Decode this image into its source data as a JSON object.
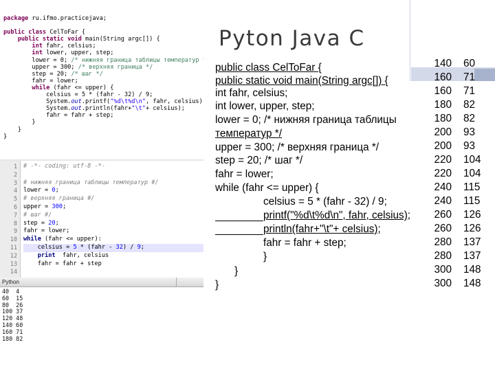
{
  "slide": {
    "title": "Pyton Java C"
  },
  "java_panel": {
    "lines": [
      [
        {
          "t": "package ",
          "c": "kw"
        },
        {
          "t": "ru.ifmo.practicejava;",
          "c": ""
        }
      ],
      [
        {
          "t": "",
          "c": ""
        }
      ],
      [
        {
          "t": "public class ",
          "c": "kw"
        },
        {
          "t": "CelToFar {",
          "c": ""
        }
      ],
      [
        {
          "t": "    ",
          "c": ""
        },
        {
          "t": "public static void ",
          "c": "kw"
        },
        {
          "t": "main(String argc[]) {",
          "c": ""
        }
      ],
      [
        {
          "t": "        ",
          "c": ""
        },
        {
          "t": "int ",
          "c": "kw"
        },
        {
          "t": "fahr, celsius;",
          "c": ""
        }
      ],
      [
        {
          "t": "        ",
          "c": ""
        },
        {
          "t": "int ",
          "c": "kw"
        },
        {
          "t": "lower, upper, step;",
          "c": ""
        }
      ],
      [
        {
          "t": "        lower = 0; ",
          "c": ""
        },
        {
          "t": "/* нижняя граница таблицы температур */",
          "c": "cm"
        }
      ],
      [
        {
          "t": "        upper = 300; ",
          "c": ""
        },
        {
          "t": "/* верхняя граница */",
          "c": "cm"
        }
      ],
      [
        {
          "t": "        step = 20; ",
          "c": ""
        },
        {
          "t": "/* шаг */",
          "c": "cm"
        }
      ],
      [
        {
          "t": "        fahr = lower;",
          "c": ""
        }
      ],
      [
        {
          "t": "        ",
          "c": ""
        },
        {
          "t": "while ",
          "c": "kw"
        },
        {
          "t": "(fahr <= upper) {",
          "c": ""
        }
      ],
      [
        {
          "t": "            celsius = 5 * (fahr - 32) / 9;",
          "c": ""
        }
      ],
      [
        {
          "t": "            System.",
          "c": ""
        },
        {
          "t": "out",
          "c": "fd"
        },
        {
          "t": ".printf(",
          "c": ""
        },
        {
          "t": "\"%d\\t%d\\n\"",
          "c": "st"
        },
        {
          "t": ", fahr, celsius);",
          "c": ""
        }
      ],
      [
        {
          "t": "            System.",
          "c": ""
        },
        {
          "t": "out",
          "c": "fd"
        },
        {
          "t": ".println(fahr+",
          "c": ""
        },
        {
          "t": "\"\\t\"",
          "c": "st"
        },
        {
          "t": "+ celsius);",
          "c": ""
        }
      ],
      [
        {
          "t": "            fahr = fahr + step;",
          "c": ""
        }
      ],
      [
        {
          "t": "        }",
          "c": ""
        }
      ],
      [
        {
          "t": "    }",
          "c": ""
        }
      ],
      [
        {
          "t": "}",
          "c": ""
        }
      ]
    ]
  },
  "python_panel": {
    "line_numbers": [
      "1",
      "2",
      "3",
      "4",
      "5",
      "6",
      "7",
      "8",
      "9",
      "10",
      "11",
      "12",
      "13",
      "14"
    ],
    "lines": [
      [
        {
          "t": "# -*- coding: utf-8 -*-",
          "c": "pcm"
        }
      ],
      [
        {
          "t": "",
          "c": ""
        }
      ],
      [
        {
          "t": "# нижняя граница таблицы температур #/",
          "c": "pcm"
        }
      ],
      [
        {
          "t": "lower = ",
          "c": ""
        },
        {
          "t": "0",
          "c": "pnum"
        },
        {
          "t": ";",
          "c": ""
        }
      ],
      [
        {
          "t": "# верхняя граница #/",
          "c": "pcm"
        }
      ],
      [
        {
          "t": "upper = ",
          "c": ""
        },
        {
          "t": "300",
          "c": "pnum"
        },
        {
          "t": ";",
          "c": ""
        }
      ],
      [
        {
          "t": "# шаг #/",
          "c": "pcm"
        }
      ],
      [
        {
          "t": "step = ",
          "c": ""
        },
        {
          "t": "20",
          "c": "pnum"
        },
        {
          "t": ";",
          "c": ""
        }
      ],
      [
        {
          "t": "fahr = lower;",
          "c": ""
        }
      ],
      [
        {
          "t": "while ",
          "c": "pkw"
        },
        {
          "t": "(fahr <= upper):",
          "c": ""
        }
      ],
      [
        {
          "t": "    celsius = ",
          "c": ""
        },
        {
          "t": "5",
          "c": "pnum"
        },
        {
          "t": " * (fahr - ",
          "c": ""
        },
        {
          "t": "32",
          "c": "pnum"
        },
        {
          "t": ") / ",
          "c": ""
        },
        {
          "t": "9",
          "c": "pnum"
        },
        {
          "t": ";",
          "c": ""
        }
      ],
      [
        {
          "t": "    ",
          "c": ""
        },
        {
          "t": "print",
          "c": "pkw"
        },
        {
          "t": "  fahr, celsius",
          "c": ""
        }
      ],
      [
        {
          "t": "    fahr = fahr + step",
          "c": ""
        }
      ],
      [
        {
          "t": "",
          "c": ""
        }
      ]
    ]
  },
  "console_panel": {
    "title": "Python",
    "lines": [
      "40  4",
      "60  15",
      "80  26",
      "100 37",
      "120 48",
      "140 60",
      "160 71",
      "180 82"
    ]
  },
  "slide_code": {
    "lines": [
      {
        "text": "public class CelToFar {",
        "underline": true
      },
      {
        "text": "public static void main(String argc[]) {",
        "underline": true
      },
      {
        "text": "int fahr, celsius;",
        "underline": false
      },
      {
        "text": "int lower, upper, step;",
        "underline": false
      },
      {
        "text": "lower = 0; /* нижняя граница таблицы",
        "underline": false
      },
      {
        "text": "температур */",
        "underline": true
      },
      {
        "text": "upper = 300; /* верхняя граница */",
        "underline": false
      },
      {
        "text": "step = 20; /* шаг */",
        "underline": false
      },
      {
        "text": "fahr = lower;",
        "underline": false
      },
      {
        "text": "while (fahr <= upper) {",
        "underline": false
      },
      {
        "text": "celsius = 5 * (fahr - 32) / 9;",
        "underline": false
      },
      {
        "text": "printf(\"%d\\t%d\\n\", fahr, celsius);",
        "underline": true
      },
      {
        "text": "println(fahr+\"\\t\"+ celsius);",
        "underline": true
      },
      {
        "text": "fahr = fahr + step;",
        "underline": false
      },
      {
        "text": "}",
        "underline": false
      },
      {
        "text": "}",
        "underline": false
      },
      {
        "text": "}",
        "underline": false
      }
    ]
  },
  "slide_table": {
    "rows": [
      [
        "140",
        "60"
      ],
      [
        "160",
        "71"
      ],
      [
        "160",
        "71"
      ],
      [
        "180",
        "82"
      ],
      [
        "180",
        "82"
      ],
      [
        "200",
        "93"
      ],
      [
        "200",
        "93"
      ],
      [
        "220",
        "104"
      ],
      [
        "220",
        "104"
      ],
      [
        "240",
        "115"
      ],
      [
        "240",
        "115"
      ],
      [
        "260",
        "126"
      ],
      [
        "260",
        "126"
      ],
      [
        "280",
        "137"
      ],
      [
        "280",
        "137"
      ],
      [
        "300",
        "148"
      ],
      [
        "300",
        "148"
      ]
    ]
  }
}
